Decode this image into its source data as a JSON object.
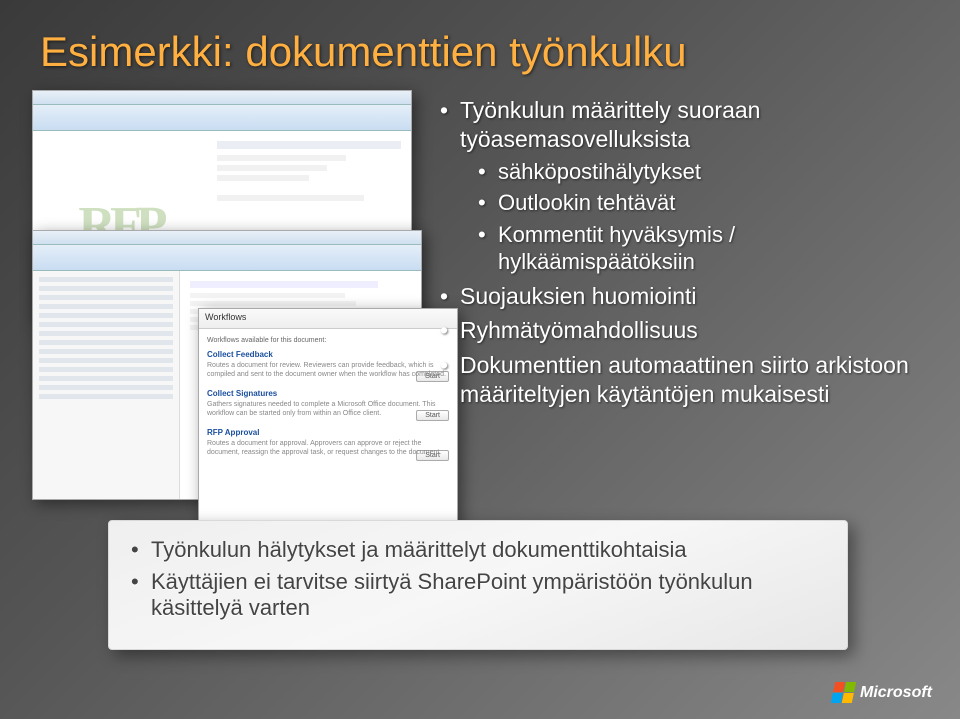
{
  "title": "Esimerkki: dokumenttien työnkulku",
  "bullets": {
    "b1": "Työnkulun määrittely suoraan työasemasovelluksista",
    "b1a": "sähköpostihälytykset",
    "b1b": "Outlookin tehtävät",
    "b1c": "Kommentit hyväksymis / hylkäämispäätöksiin",
    "b2": "Suojauksien huomiointi",
    "b3": "Ryhmätyömahdollisuus",
    "b4": "Dokumenttien automaattinen siirto arkistoon määriteltyjen käytäntöjen mukaisesti"
  },
  "bottom": {
    "b1": "Työnkulun hälytykset ja määrittelyt dokumenttikohtaisia",
    "b2": "Käyttäjien ei tarvitse siirtyä SharePoint ympäristöön työnkulun käsittelyä varten"
  },
  "screenshots": {
    "rfp": "RFP",
    "dlg_title": "Workflows",
    "dlg_avail": "Workflows available for this document:",
    "sec1": "Collect Feedback",
    "sec1_text": "Routes a document for review. Reviewers can provide feedback, which is compiled and sent to the document owner when the workflow has completed.",
    "sec2": "Collect Signatures",
    "sec2_text": "Gathers signatures needed to complete a Microsoft Office document. This workflow can be started only from within an Office client.",
    "sec3": "RFP Approval",
    "sec3_text": "Routes a document for approval. Approvers can approve or reject the document, reassign the approval task, or request changes to the document.",
    "start_btn": "Start"
  },
  "logo": "Microsoft"
}
